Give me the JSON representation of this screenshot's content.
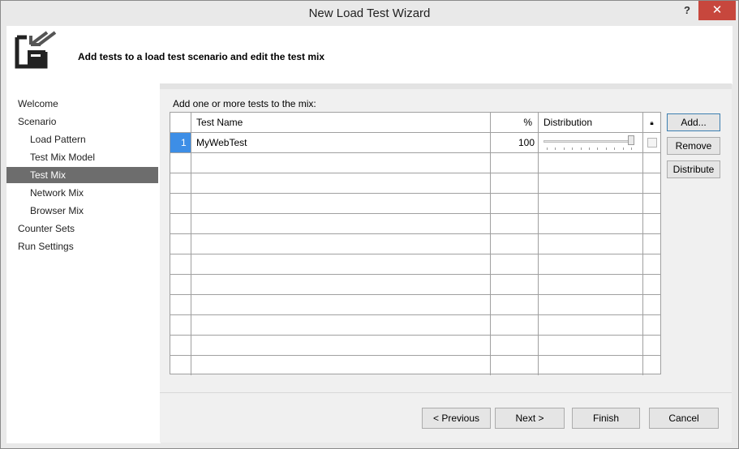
{
  "window": {
    "title": "New Load Test Wizard",
    "help_label": "?",
    "close_label": "✕"
  },
  "header": {
    "text": "Add tests to a load test scenario and edit the test mix"
  },
  "sidebar": {
    "items": [
      {
        "label": "Welcome",
        "level": 1
      },
      {
        "label": "Scenario",
        "level": 1
      },
      {
        "label": "Load Pattern",
        "level": 2
      },
      {
        "label": "Test Mix Model",
        "level": 2
      },
      {
        "label": "Test Mix",
        "level": 2,
        "selected": true
      },
      {
        "label": "Network Mix",
        "level": 2
      },
      {
        "label": "Browser Mix",
        "level": 2
      },
      {
        "label": "Counter Sets",
        "level": 1
      },
      {
        "label": "Run Settings",
        "level": 1
      }
    ]
  },
  "main": {
    "grid_label": "Add one or more tests to the mix:",
    "columns": {
      "test_name": "Test Name",
      "percent": "%",
      "distribution": "Distribution",
      "lock": "🔒"
    },
    "rows": [
      {
        "num": "1",
        "test_name": "MyWebTest",
        "percent": "100",
        "distribution": 100,
        "locked": false
      }
    ],
    "empty_rows": 11,
    "buttons": {
      "add": "Add...",
      "remove": "Remove",
      "distribute": "Distribute"
    }
  },
  "footer": {
    "previous": "< Previous",
    "next": "Next >",
    "finish": "Finish",
    "cancel": "Cancel"
  },
  "colors": {
    "close_button": "#c7473d",
    "selected_nav": "#6d6d6d",
    "selected_row_number": "#3d8ee6"
  }
}
